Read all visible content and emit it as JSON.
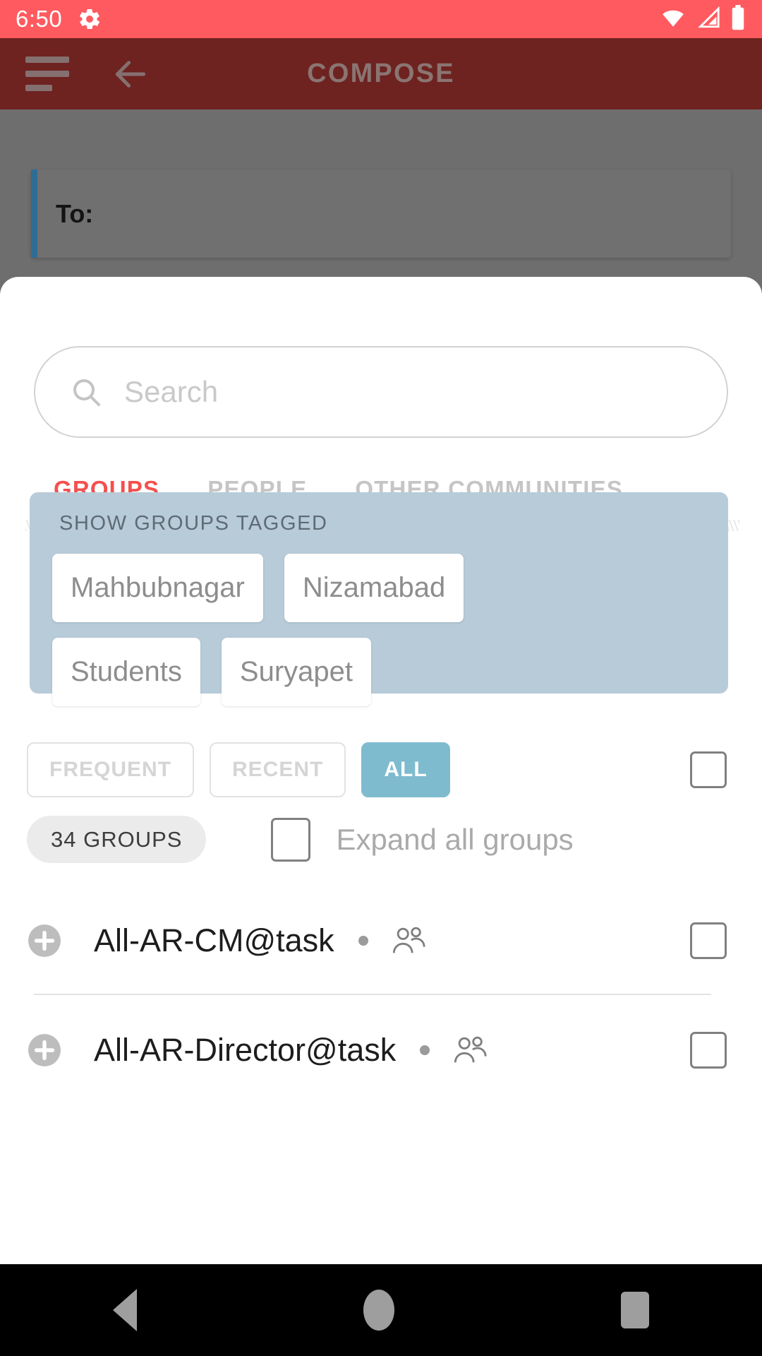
{
  "status_bar": {
    "time": "6:50",
    "icons": [
      "gear-icon",
      "wifi-icon",
      "signal-icon",
      "battery-icon"
    ],
    "background": "#ff5a5f"
  },
  "toolbar": {
    "title": "COMPOSE",
    "menu_icon": "hamburger-icon",
    "back_icon": "back-arrow-icon",
    "background": "#6e2320",
    "title_color": "#8a7572"
  },
  "compose": {
    "to_label": "To:",
    "accent_color": "#2e6d95"
  },
  "search": {
    "placeholder": "Search",
    "value": "",
    "icon": "search-icon"
  },
  "tabs": [
    {
      "label": "GROUPS",
      "active": true
    },
    {
      "label": "PEOPLE",
      "active": false
    },
    {
      "label": "OTHER COMMUNITIES",
      "active": false
    }
  ],
  "active_tab_color": "#f4504e",
  "tagged_panel": {
    "title": "SHOW GROUPS TAGGED",
    "background": "#b8cbd9",
    "rows": [
      [
        "Mahbubnagar",
        "Nizamabad"
      ],
      [
        "Students",
        "Suryapet"
      ]
    ]
  },
  "filters": [
    {
      "label": "FREQUENT",
      "active": false
    },
    {
      "label": "RECENT",
      "active": false
    },
    {
      "label": "ALL",
      "active": true
    }
  ],
  "filter_active_color": "#7fbbcf",
  "select_all_checkbox": {
    "checked": false
  },
  "count_row": {
    "count_label": "34 GROUPS",
    "expand_label": "Expand all groups",
    "expand_checked": false
  },
  "groups": [
    {
      "name": "All-AR-CM@task",
      "expand_icon": "plus-circle-icon",
      "type_icon": "people-group-icon",
      "checked": false
    },
    {
      "name": "All-AR-Director@task",
      "expand_icon": "plus-circle-icon",
      "type_icon": "people-group-icon",
      "checked": false
    }
  ],
  "nav_bar": {
    "back": "back-triangle-icon",
    "home": "home-circle-icon",
    "recent": "recent-square-icon"
  }
}
